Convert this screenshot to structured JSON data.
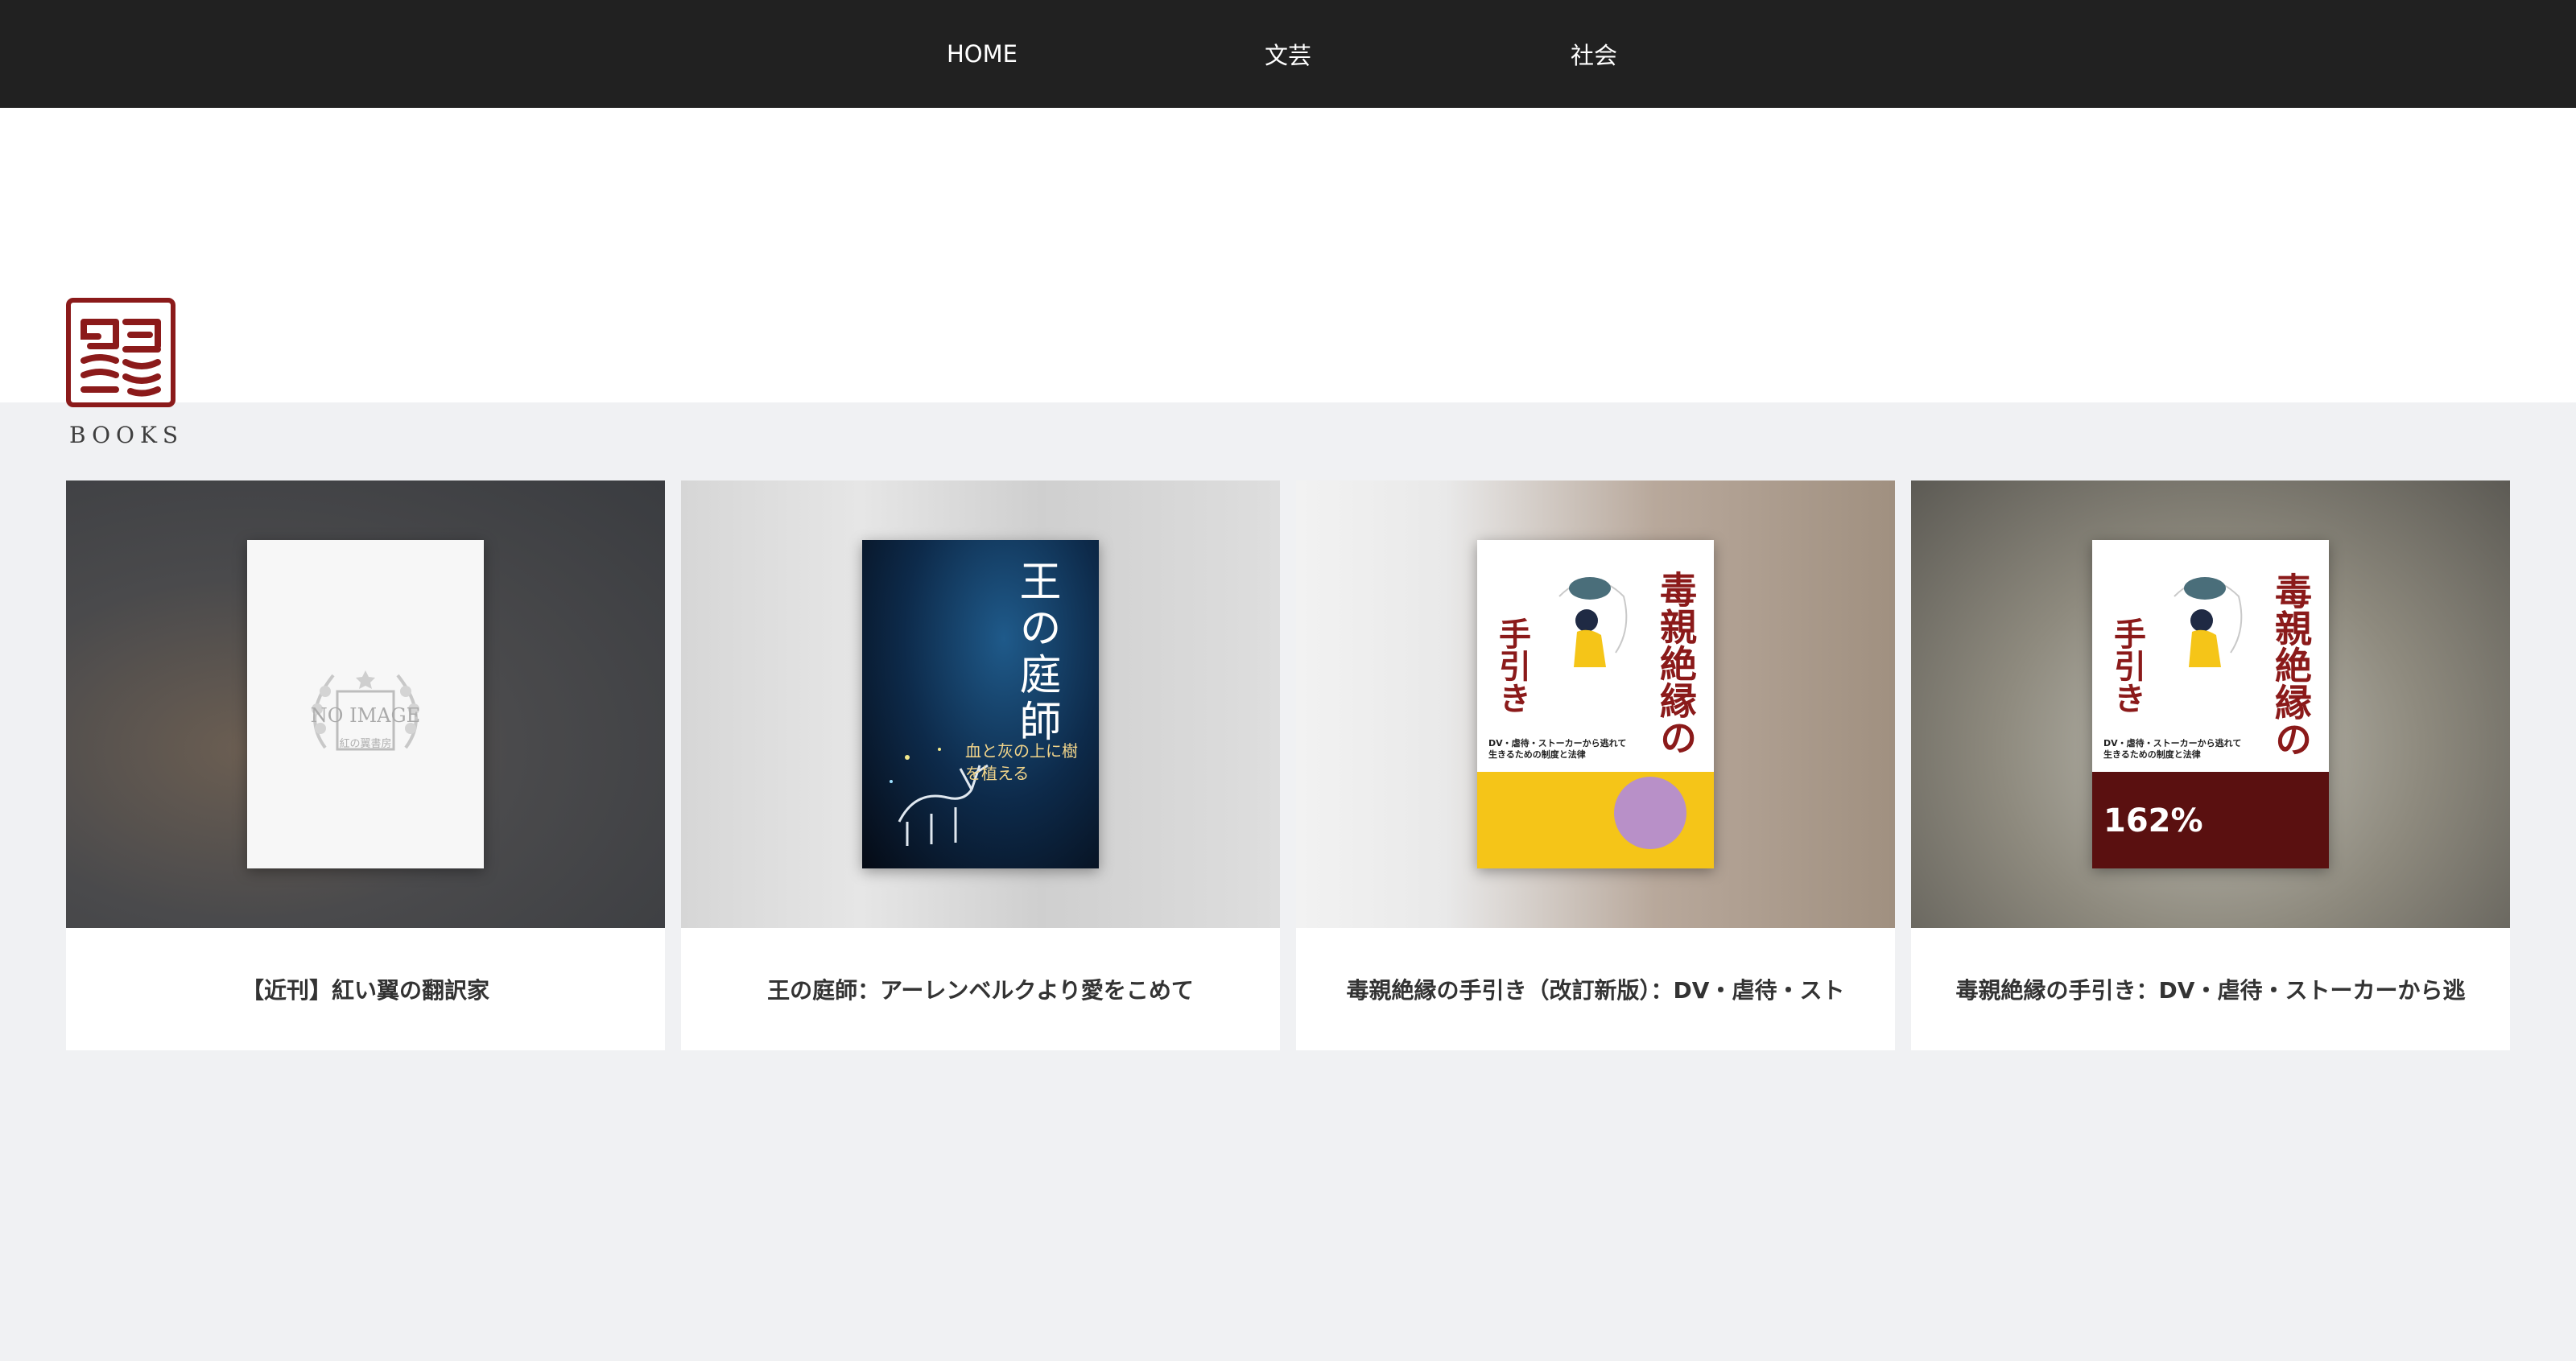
{
  "nav": {
    "items": [
      {
        "label": "HOME"
      },
      {
        "label": "文芸"
      },
      {
        "label": "社会"
      }
    ]
  },
  "logo": {
    "text": "BOOKS",
    "accent": "#8b1a1a"
  },
  "cards": [
    {
      "title": "【近刊】紅い翼の翻訳家",
      "cover_text": "NO IMAGE",
      "cover_sub": "紅の翼書房"
    },
    {
      "title": "王の庭師：アーレンベルクより愛をこめて",
      "cover_text": "王の庭師",
      "cover_sub": "血と灰の上に樹を植える"
    },
    {
      "title": "毒親絶縁の手引き（改訂新版）：DV・虐待・スト",
      "cover_text": "毒親絶縁の",
      "cover_text2": "手引き",
      "cover_sub": "DV・虐待・ストーカーから逃れて生きるための制度と法律"
    },
    {
      "title": "毒親絶縁の手引き：DV・虐待・ストーカーから逃",
      "cover_text": "毒親絶縁の",
      "cover_text2": "手引き",
      "cover_sub": "DV・虐待・ストーカーから逃れて生きるための制度と法律",
      "cover_badge": "162%"
    }
  ],
  "colors": {
    "nav_bg": "#212121",
    "page_bg": "#f0f1f3",
    "accent": "#8b1a1a"
  }
}
